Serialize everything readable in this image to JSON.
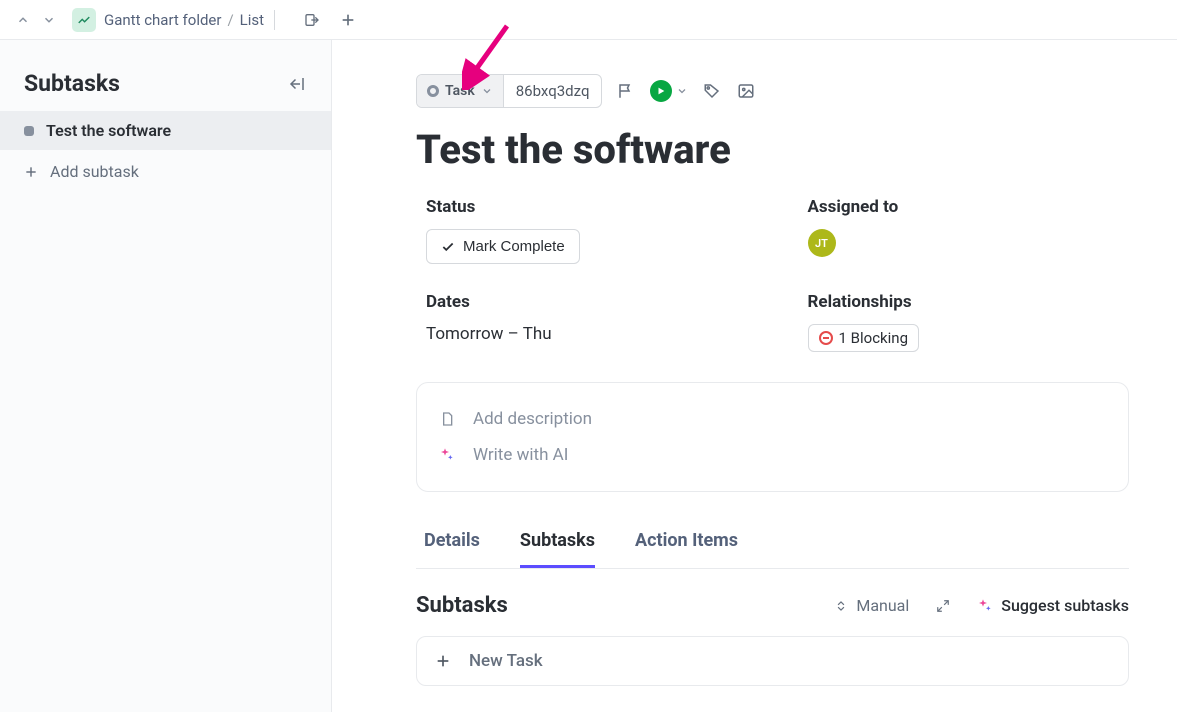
{
  "breadcrumb": {
    "folder": "Gantt chart folder",
    "view": "List"
  },
  "side": {
    "title": "Subtasks",
    "item": "Test the software",
    "add": "Add subtask"
  },
  "task": {
    "type_label": "Task",
    "id": "86bxq3dzq",
    "title": "Test the software"
  },
  "fields": {
    "status_label": "Status",
    "status_action": "Mark Complete",
    "assigned_label": "Assigned to",
    "assignee_initials": "JT",
    "dates_label": "Dates",
    "dates_value": "Tomorrow – Thu",
    "relationships_label": "Relationships",
    "relationships_value": "1 Blocking"
  },
  "description": {
    "add": "Add description",
    "ai": "Write with AI"
  },
  "tabs": {
    "details": "Details",
    "subtasks": "Subtasks",
    "action_items": "Action Items"
  },
  "subtasks_section": {
    "heading": "Subtasks",
    "sort": "Manual",
    "suggest": "Suggest subtasks",
    "new_task": "New Task"
  }
}
